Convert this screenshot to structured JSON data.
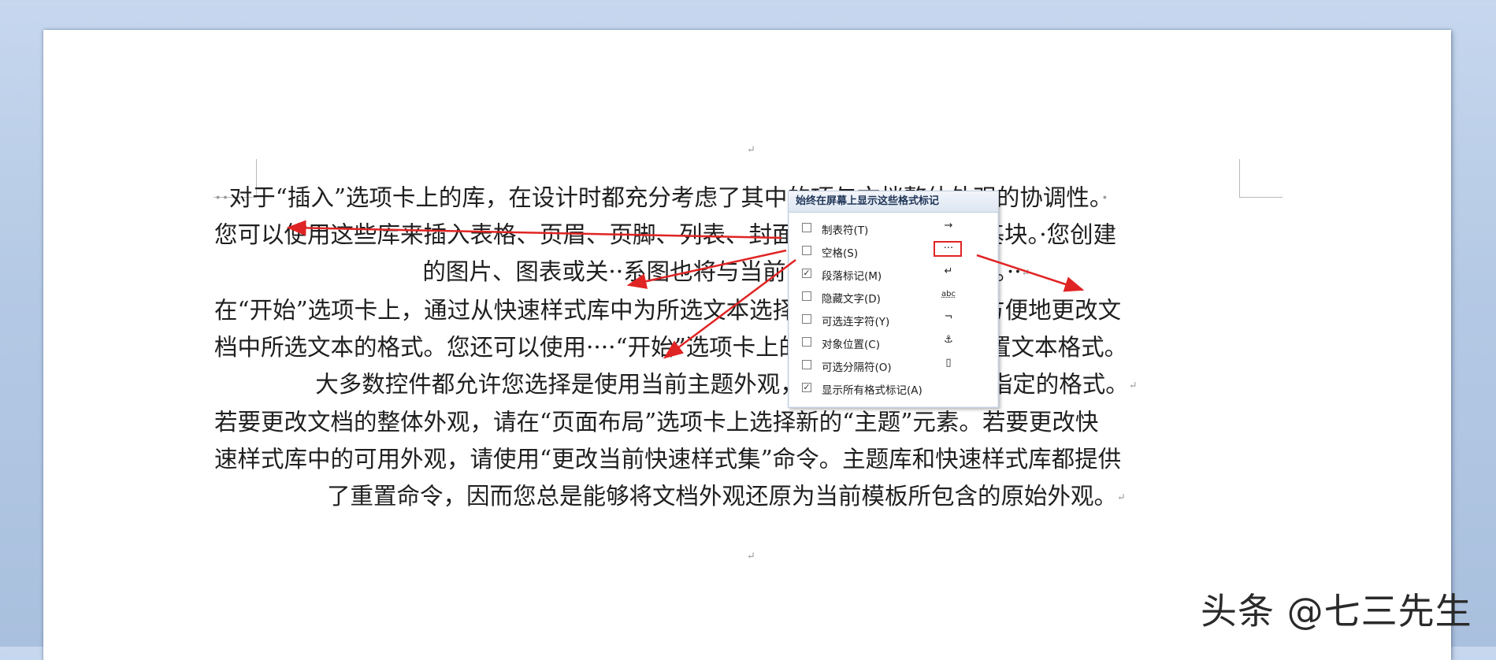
{
  "document": {
    "header_mark": "↵",
    "footer_mark": "↵",
    "lines": [
      {
        "lead": "··",
        "text": "对于“插入”选项卡上的库，在设计时都充分考虑了其中的项与文档整体外观的协调性。",
        "tail": "·",
        "align": "left"
      },
      {
        "lead": "",
        "text": "您可以使用这些库来插入表格、页眉、页脚、列表、封面以及其他文档构建基块。·您创建",
        "tail": "",
        "align": "left"
      },
      {
        "lead": "",
        "text": "的图片、图表或关··系图也将与当前的文档外观协调一致。··",
        "tail": "↵",
        "align": "center"
      },
      {
        "lead": "",
        "text": "在“开始”选项卡上，通过从快速样式库中为所选文本选择一种外观，您可以方便地更改文",
        "tail": "",
        "align": "left"
      },
      {
        "lead": "",
        "text": "档中所选文本的格式。您还可以使用····“开始”选项卡上的其他控件来直接设置文本格式。",
        "tail": "",
        "align": "left"
      },
      {
        "lead": "",
        "text": "大多数控件都允许您选择是使用当前主题外观，还是使用某种直接指定的格式。",
        "tail": "↵",
        "align": "center"
      },
      {
        "lead": "",
        "text": "若要更改文档的整体外观，请在“页面布局”选项卡上选择新的“主题”元素。若要更改快",
        "tail": "",
        "align": "left"
      },
      {
        "lead": "",
        "text": "速样式库中的可用外观，请使用“更改当前快速样式集”命令。主题库和快速样式库都提供",
        "tail": "",
        "align": "left"
      },
      {
        "lead": "",
        "text": "了重置命令，因而您总是能够将文档外观还原为当前模板所包含的原始外观。",
        "tail": "↵",
        "align": "center"
      }
    ]
  },
  "menu": {
    "title": "始终在屏幕上显示这些格式标记",
    "items": [
      {
        "label": "制表符(T)",
        "checked": false,
        "symbol": "→"
      },
      {
        "label": "空格(S)",
        "checked": false,
        "symbol": "···"
      },
      {
        "label": "段落标记(M)",
        "checked": true,
        "symbol": "↵"
      },
      {
        "label": "隐藏文字(D)",
        "checked": false,
        "symbol": "abc"
      },
      {
        "label": "可选连字符(Y)",
        "checked": false,
        "symbol": "¬"
      },
      {
        "label": "对象位置(C)",
        "checked": false,
        "symbol": "⚓"
      },
      {
        "label": "可选分隔符(O)",
        "checked": false,
        "symbol": "▯"
      },
      {
        "label": "显示所有格式标记(A)",
        "checked": true,
        "symbol": ""
      }
    ]
  },
  "watermark": "头条 @七三先生",
  "colors": {
    "annotation_red": "#e02424",
    "accent_blue": "#1f3557"
  }
}
